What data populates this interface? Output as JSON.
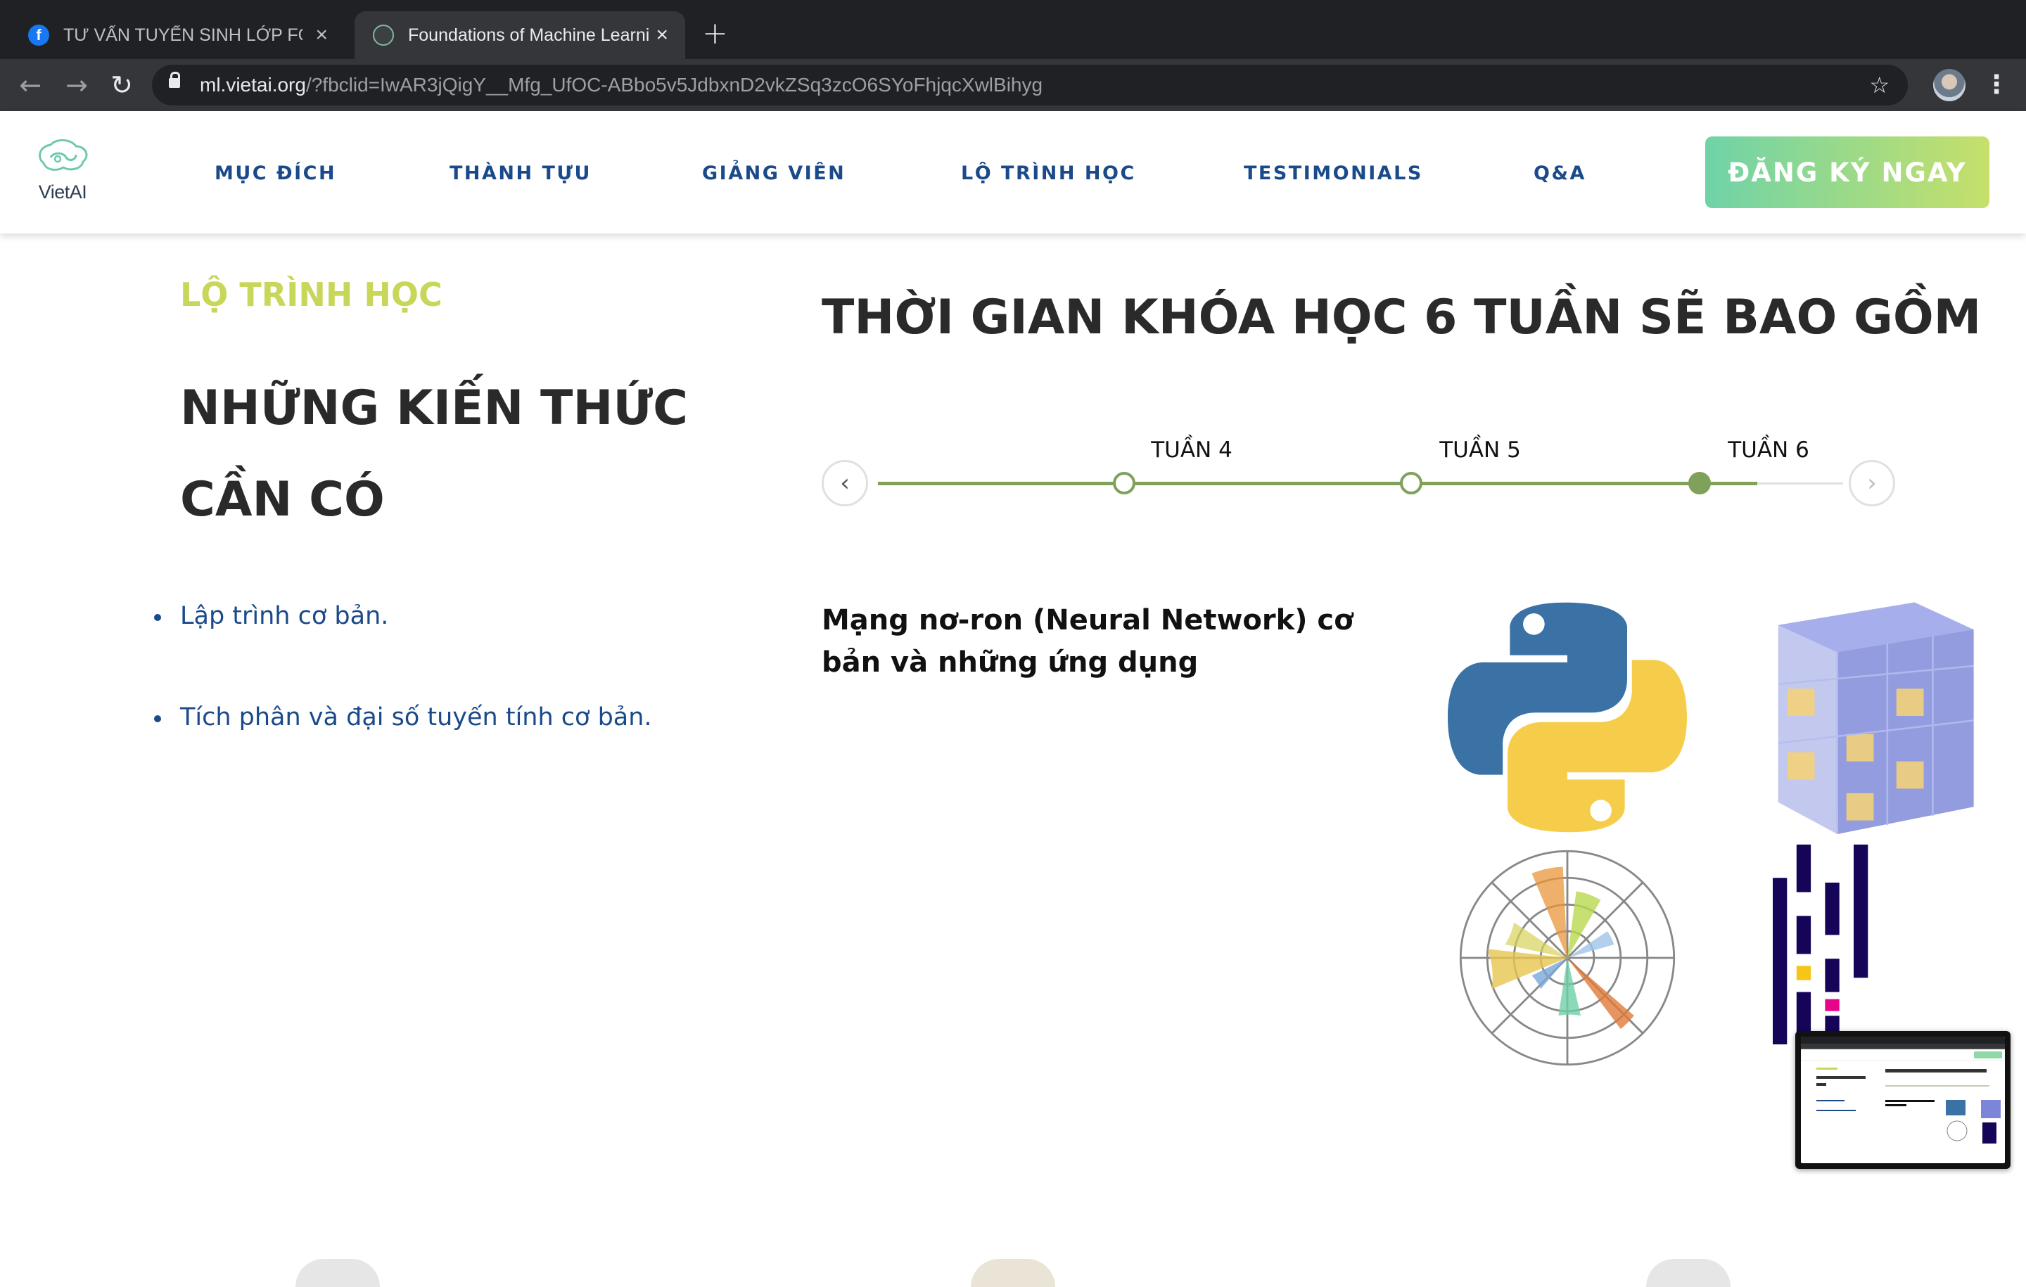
{
  "browser": {
    "tabs": [
      {
        "title": "TƯ VẤN TUYỂN SINH LỚP FOU",
        "icon": "facebook-icon",
        "active": false
      },
      {
        "title": "Foundations of Machine Learni",
        "icon": "vietai-favicon",
        "active": true
      }
    ],
    "new_tab_label": "+",
    "close_label": "×",
    "url": {
      "host": "ml.vietai.org",
      "path": "/?fbclid=IwAR3jQigY__Mfg_UfOC-ABbo5v5JdbxnD2vkZSq3zcO6SYoFhjqcXwlBihyg"
    }
  },
  "site": {
    "logo_text": "VietAI",
    "nav": [
      "MỤC ĐÍCH",
      "THÀNH TỰU",
      "GIẢNG VIÊN",
      "LỘ TRÌNH HỌC",
      "TESTIMONIALS",
      "Q&A"
    ],
    "cta_label": "ĐĂNG KÝ NGAY",
    "cta_gradient": [
      "#6fd3a8",
      "#c6e06a"
    ],
    "accent_color": "#c8d65a",
    "nav_color": "#1a4a8a"
  },
  "content": {
    "eyebrow": "LỘ TRÌNH HỌC",
    "left_heading": "NHỮNG KIẾN THỨC CẦN CÓ",
    "prerequisites": [
      "Lập trình cơ bản.",
      "Tích phân và đại số tuyến tính cơ bản."
    ],
    "right_heading": "THỜI GIAN KHÓA HỌC 6 TUẦN SẼ BAO GỒM",
    "timeline": {
      "weeks": [
        "TUẦN 4",
        "TUẦN 5",
        "TUẦN 6"
      ],
      "active_index": 2,
      "prev_label": "‹",
      "next_label": "›"
    },
    "week_topic": "Mạng nơ-ron (Neural Network) cơ bản và những ứng dụng",
    "illustrations": [
      "python-logo",
      "numpy-cube-logo",
      "polar-chart-icon",
      "pandas-logo"
    ]
  }
}
